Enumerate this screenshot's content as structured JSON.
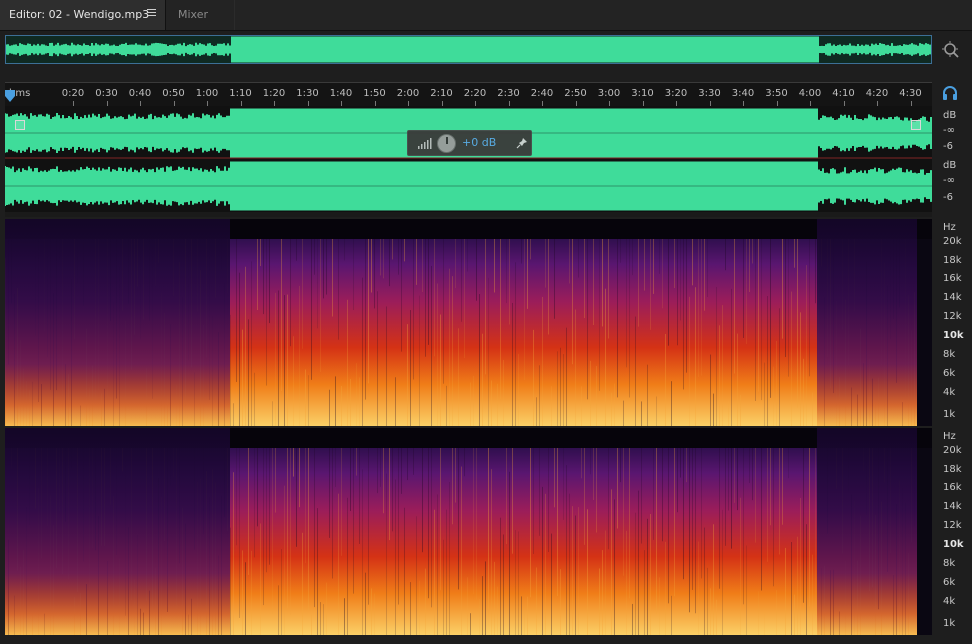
{
  "tabs": {
    "editor_label": "Editor: 02 - Wendigo.mp3",
    "mixer_label": "Mixer"
  },
  "ruler": {
    "unit": "hms",
    "labels": [
      "0:20",
      "0:30",
      "0:40",
      "0:50",
      "1:00",
      "1:10",
      "1:20",
      "1:30",
      "1:40",
      "1:50",
      "2:00",
      "2:10",
      "2:20",
      "2:30",
      "2:40",
      "2:50",
      "3:00",
      "3:10",
      "3:20",
      "3:30",
      "3:40",
      "3:50",
      "4:00",
      "4:10",
      "4:20",
      "4:30"
    ]
  },
  "level_control": {
    "value": "+0 dB"
  },
  "amplitude_scale": {
    "unit": "dB",
    "ch1": [
      "-∞",
      "-6"
    ],
    "ch2": [
      "-∞",
      "-6"
    ]
  },
  "frequency_scale": {
    "unit": "Hz",
    "labels": [
      "20k",
      "18k",
      "16k",
      "14k",
      "12k",
      "10k",
      "8k",
      "6k",
      "4k",
      "1k"
    ]
  },
  "colors": {
    "waveform": "#3fdc9a",
    "accent": "#4a9fe0",
    "spectral_low": "#fbd067",
    "spectral_high": "#2a0e4a"
  },
  "icons": {
    "zoom": "zoom-navigator-icon",
    "headphones": "headphones-icon",
    "pin": "pin-icon"
  }
}
